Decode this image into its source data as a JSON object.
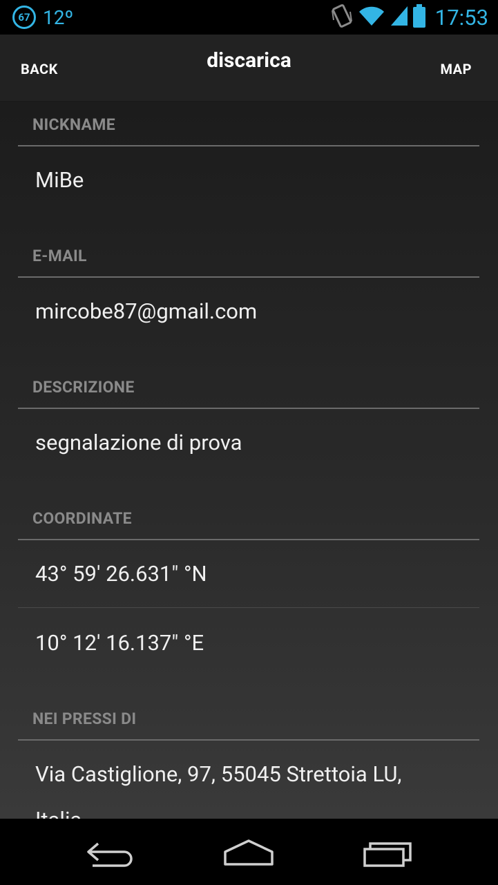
{
  "status_bar": {
    "badge": "67",
    "temperature": "12º",
    "time": "17:53",
    "icons": [
      "vibrate-icon",
      "wifi-icon",
      "signal-icon",
      "battery-icon"
    ]
  },
  "action_bar": {
    "back_label": "BACK",
    "title": "discarica",
    "map_label": "MAP"
  },
  "fields": {
    "nickname": {
      "label": "NICKNAME",
      "value": "MiBe"
    },
    "email": {
      "label": "E-MAIL",
      "value": "mircobe87@gmail.com"
    },
    "description": {
      "label": "DESCRIZIONE",
      "value": "segnalazione di prova"
    },
    "coordinates": {
      "label": "COORDINATE",
      "latitude": "43° 59' 26.631\" °N",
      "longitude": "10° 12' 16.137\" °E"
    },
    "nearby": {
      "label": "NEI PRESSI DI",
      "value_line1": "Via Castiglione, 97, 55045 Strettoia LU,",
      "value_line2": "Italia"
    }
  },
  "colors": {
    "accent": "#33b5e5",
    "header_text": "#8a8a8a",
    "value_text": "#f0f0f0"
  }
}
